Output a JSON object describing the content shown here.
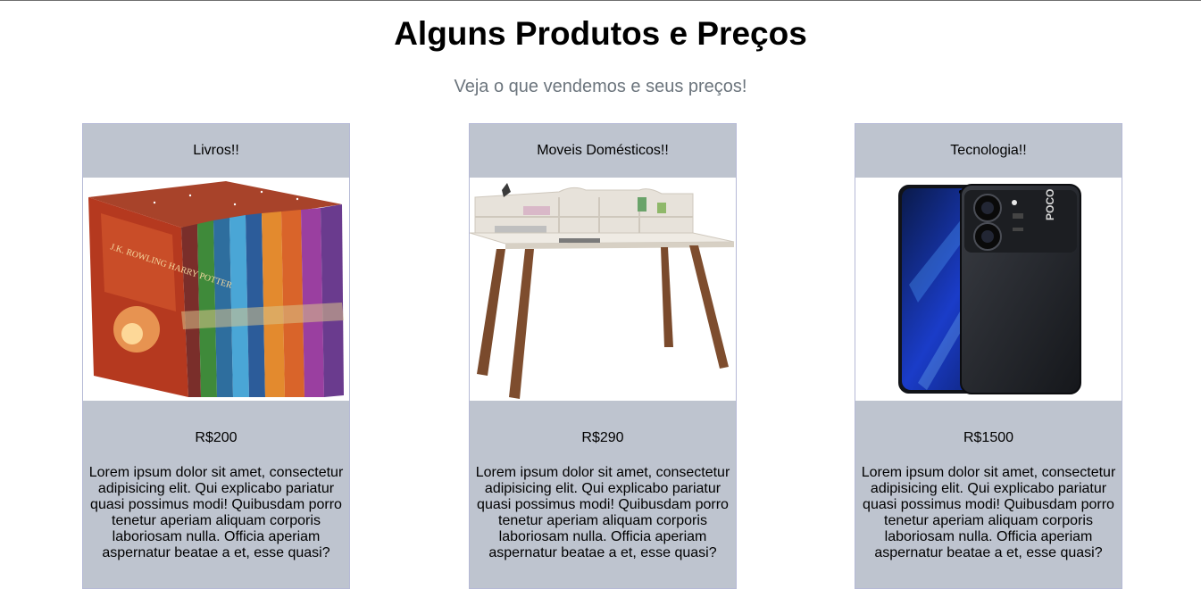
{
  "header": {
    "title": "Alguns Produtos e Preços",
    "subtitle": "Veja o que vendemos e seus preços!"
  },
  "products": [
    {
      "category": "Livros!!",
      "price": "R$200",
      "description": "Lorem ipsum dolor sit amet, consectetur adipisicing elit. Qui explicabo pariatur quasi possimus modi! Quibusdam porro tenetur aperiam aliquam corporis laboriosam nulla. Officia aperiam aspernatur beatae a et, esse quasi?",
      "image": "book-box-set-image",
      "image_text": "J.K. ROWLING HARRY POTTER"
    },
    {
      "category": "Moveis Domésticos!!",
      "price": "R$290",
      "description": "Lorem ipsum dolor sit amet, consectetur adipisicing elit. Qui explicabo pariatur quasi possimus modi! Quibusdam porro tenetur aperiam aliquam corporis laboriosam nulla. Officia aperiam aspernatur beatae a et, esse quasi?",
      "image": "desk-image"
    },
    {
      "category": "Tecnologia!!",
      "price": "R$1500",
      "description": "Lorem ipsum dolor sit amet, consectetur adipisicing elit. Qui explicabo pariatur quasi possimus modi! Quibusdam porro tenetur aperiam aliquam corporis laboriosam nulla. Officia aperiam aspernatur beatae a et, esse quasi?",
      "image": "smartphone-image",
      "image_text": "POCO"
    }
  ],
  "colors": {
    "card_background": "#bec4cf",
    "subtitle": "#6c757d"
  }
}
